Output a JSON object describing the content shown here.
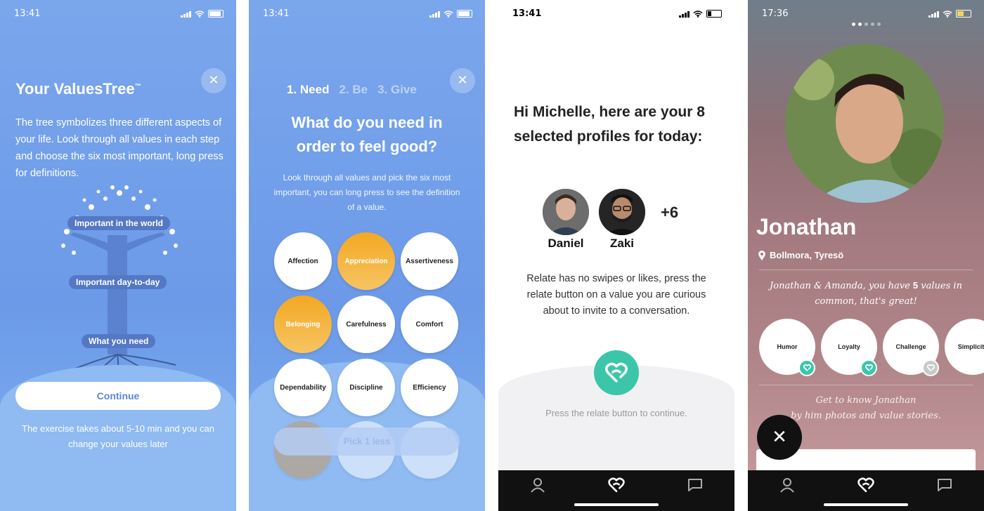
{
  "screen1": {
    "time": "13:41",
    "title": "Your ValuesTree",
    "trademark": "™",
    "description": "The tree symbolizes three different aspects of your life. Look through all values in each step and choose the six most important, long press for definitions.",
    "tree_labels": [
      "Important in the world",
      "Important day-to-day",
      "What you need"
    ],
    "continue_label": "Continue",
    "footer_note": "The exercise takes about 5-10 min and you can change your values later"
  },
  "screen2": {
    "time": "13:41",
    "steps": [
      "1. Need",
      "2. Be",
      "3. Give"
    ],
    "heading": "What do you need in order to feel good?",
    "description": "Look through all values and pick the six most important, you can long press to see the definition of a value.",
    "values": [
      {
        "label": "Affection",
        "selected": false
      },
      {
        "label": "Appreciation",
        "selected": true
      },
      {
        "label": "Assertiveness",
        "selected": false
      },
      {
        "label": "Belonging",
        "selected": true
      },
      {
        "label": "Carefulness",
        "selected": false
      },
      {
        "label": "Comfort",
        "selected": false
      },
      {
        "label": "Dependability",
        "selected": false
      },
      {
        "label": "Discipline",
        "selected": false
      },
      {
        "label": "Efficiency",
        "selected": false
      }
    ],
    "pick_label": "Pick 1 less"
  },
  "screen3": {
    "time": "13:41",
    "heading": "Hi Michelle, here are your 8 selected profiles for today:",
    "profiles": [
      "Daniel",
      "Zaki"
    ],
    "more_count": "+6",
    "description": "Relate has no swipes or likes, press the relate button on a value you are curious about to invite to a conversation.",
    "press_note": "Press the relate button to continue."
  },
  "screen4": {
    "time": "17:36",
    "name": "Jonathan",
    "location": "Bollmora, Tyresö",
    "common_pre": "Jonathan & Amanda, you have",
    "common_count": "5",
    "common_post": "values in common, that's great!",
    "values": [
      {
        "label": "Humor",
        "badge": "green"
      },
      {
        "label": "Loyalty",
        "badge": "green"
      },
      {
        "label": "Challenge",
        "badge": "grey"
      },
      {
        "label": "Simplicity",
        "badge": "none"
      }
    ],
    "know_line1": "Get to know Jonathan",
    "know_line2": "by him photos and value stories."
  },
  "colors": {
    "brand_blue": "#6c9ae8",
    "selected_orange": "#f3a822",
    "relate_teal": "#3cc6a9"
  }
}
